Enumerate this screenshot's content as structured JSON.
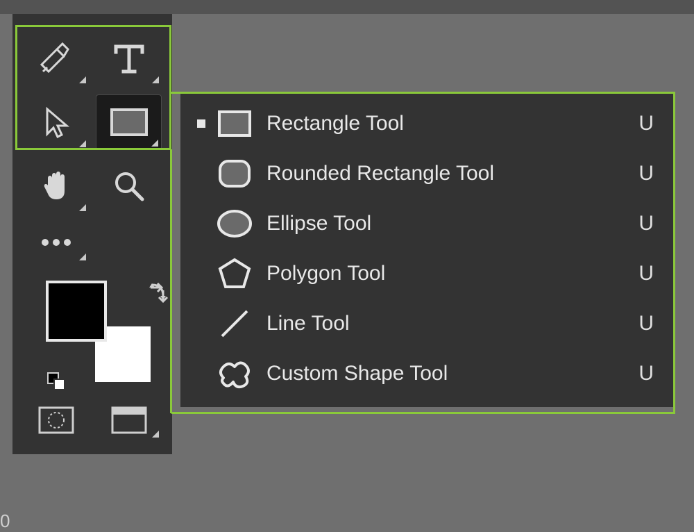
{
  "toolbox": {
    "tools": [
      {
        "name": "pen-tool",
        "has_flyout": true
      },
      {
        "name": "type-tool",
        "has_flyout": true
      },
      {
        "name": "path-selection-tool",
        "has_flyout": true
      },
      {
        "name": "rectangle-tool",
        "has_flyout": true,
        "active": true
      },
      {
        "name": "hand-tool",
        "has_flyout": true
      },
      {
        "name": "zoom-tool",
        "has_flyout": false
      },
      {
        "name": "more-tools",
        "has_flyout": true
      }
    ],
    "swatches": {
      "foreground": "#000000",
      "background": "#ffffff"
    }
  },
  "flyout": {
    "items": [
      {
        "selected": true,
        "icon": "rectangle-icon",
        "label": "Rectangle Tool",
        "shortcut": "U"
      },
      {
        "selected": false,
        "icon": "rounded-rectangle-icon",
        "label": "Rounded Rectangle Tool",
        "shortcut": "U"
      },
      {
        "selected": false,
        "icon": "ellipse-icon",
        "label": "Ellipse Tool",
        "shortcut": "U"
      },
      {
        "selected": false,
        "icon": "polygon-icon",
        "label": "Polygon Tool",
        "shortcut": "U"
      },
      {
        "selected": false,
        "icon": "line-icon",
        "label": "Line Tool",
        "shortcut": "U"
      },
      {
        "selected": false,
        "icon": "custom-shape-icon",
        "label": "Custom Shape Tool",
        "shortcut": "U"
      }
    ]
  },
  "zoom_level": "0"
}
